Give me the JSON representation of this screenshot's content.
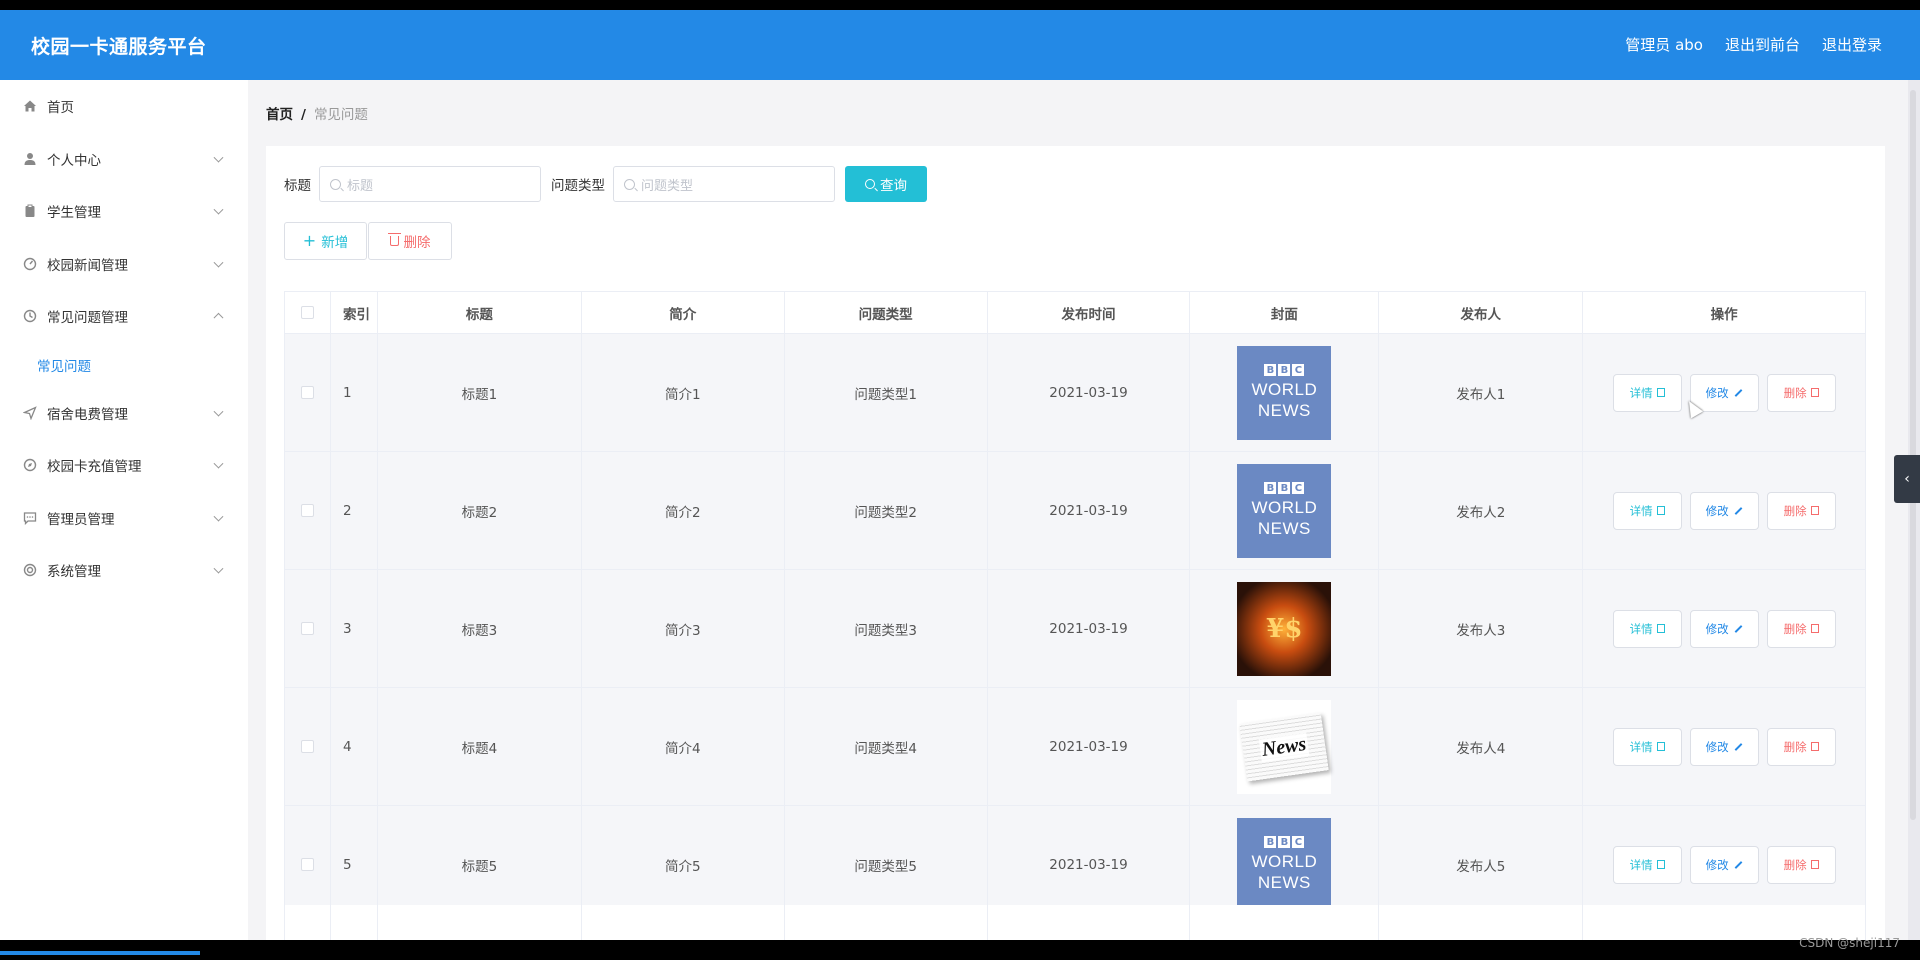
{
  "app": {
    "title": "校园一卡通服务平台"
  },
  "header": {
    "user": "管理员 abo",
    "to_front": "退出到前台",
    "logout": "退出登录"
  },
  "sidebar": {
    "items": [
      {
        "label": "首页",
        "icon": "home-icon"
      },
      {
        "label": "个人中心",
        "icon": "user-icon"
      },
      {
        "label": "学生管理",
        "icon": "clipboard-icon"
      },
      {
        "label": "校园新闻管理",
        "icon": "gauge-icon"
      },
      {
        "label": "常见问题管理",
        "icon": "clock-icon",
        "expanded": true
      },
      {
        "label": "宿舍电费管理",
        "icon": "send-icon"
      },
      {
        "label": "校园卡充值管理",
        "icon": "compass-icon"
      },
      {
        "label": "管理员管理",
        "icon": "chat-icon"
      },
      {
        "label": "系统管理",
        "icon": "lifebuoy-icon"
      }
    ],
    "sub_item": "常见问题"
  },
  "breadcrumb": {
    "home": "首页",
    "separator": "/",
    "current": "常见问题"
  },
  "search": {
    "title_label": "标题",
    "title_placeholder": "标题",
    "type_label": "问题类型",
    "type_placeholder": "问题类型",
    "query_button": "查询"
  },
  "actions": {
    "add": "新增",
    "delete": "删除"
  },
  "table": {
    "headers": [
      "索引",
      "标题",
      "简介",
      "问题类型",
      "发布时间",
      "封面",
      "发布人",
      "操作"
    ],
    "rows": [
      {
        "index": "1",
        "title": "标题1",
        "brief": "简介1",
        "type": "问题类型1",
        "time": "2021-03-19",
        "publisher": "发布人1",
        "cover": "bbc"
      },
      {
        "index": "2",
        "title": "标题2",
        "brief": "简介2",
        "type": "问题类型2",
        "time": "2021-03-19",
        "publisher": "发布人2",
        "cover": "bbc"
      },
      {
        "index": "3",
        "title": "标题3",
        "brief": "简介3",
        "type": "问题类型3",
        "time": "2021-03-19",
        "publisher": "发布人3",
        "cover": "money"
      },
      {
        "index": "4",
        "title": "标题4",
        "brief": "简介4",
        "type": "问题类型4",
        "time": "2021-03-19",
        "publisher": "发布人4",
        "cover": "news"
      },
      {
        "index": "5",
        "title": "标题5",
        "brief": "简介5",
        "type": "问题类型5",
        "time": "2021-03-19",
        "publisher": "发布人5",
        "cover": "bbc"
      }
    ],
    "op_labels": {
      "detail": "详情",
      "edit": "修改",
      "delete": "删除"
    },
    "cover_text": {
      "bbc_boxes": [
        "B",
        "B",
        "C"
      ],
      "bbc_line1": "WORLD",
      "bbc_line2": "NEWS",
      "news": "News"
    }
  },
  "watermark": "CSDN @sheji117",
  "colors": {
    "primary": "#2389e6",
    "accent": "#23bfd6",
    "danger": "#f56c6c"
  }
}
